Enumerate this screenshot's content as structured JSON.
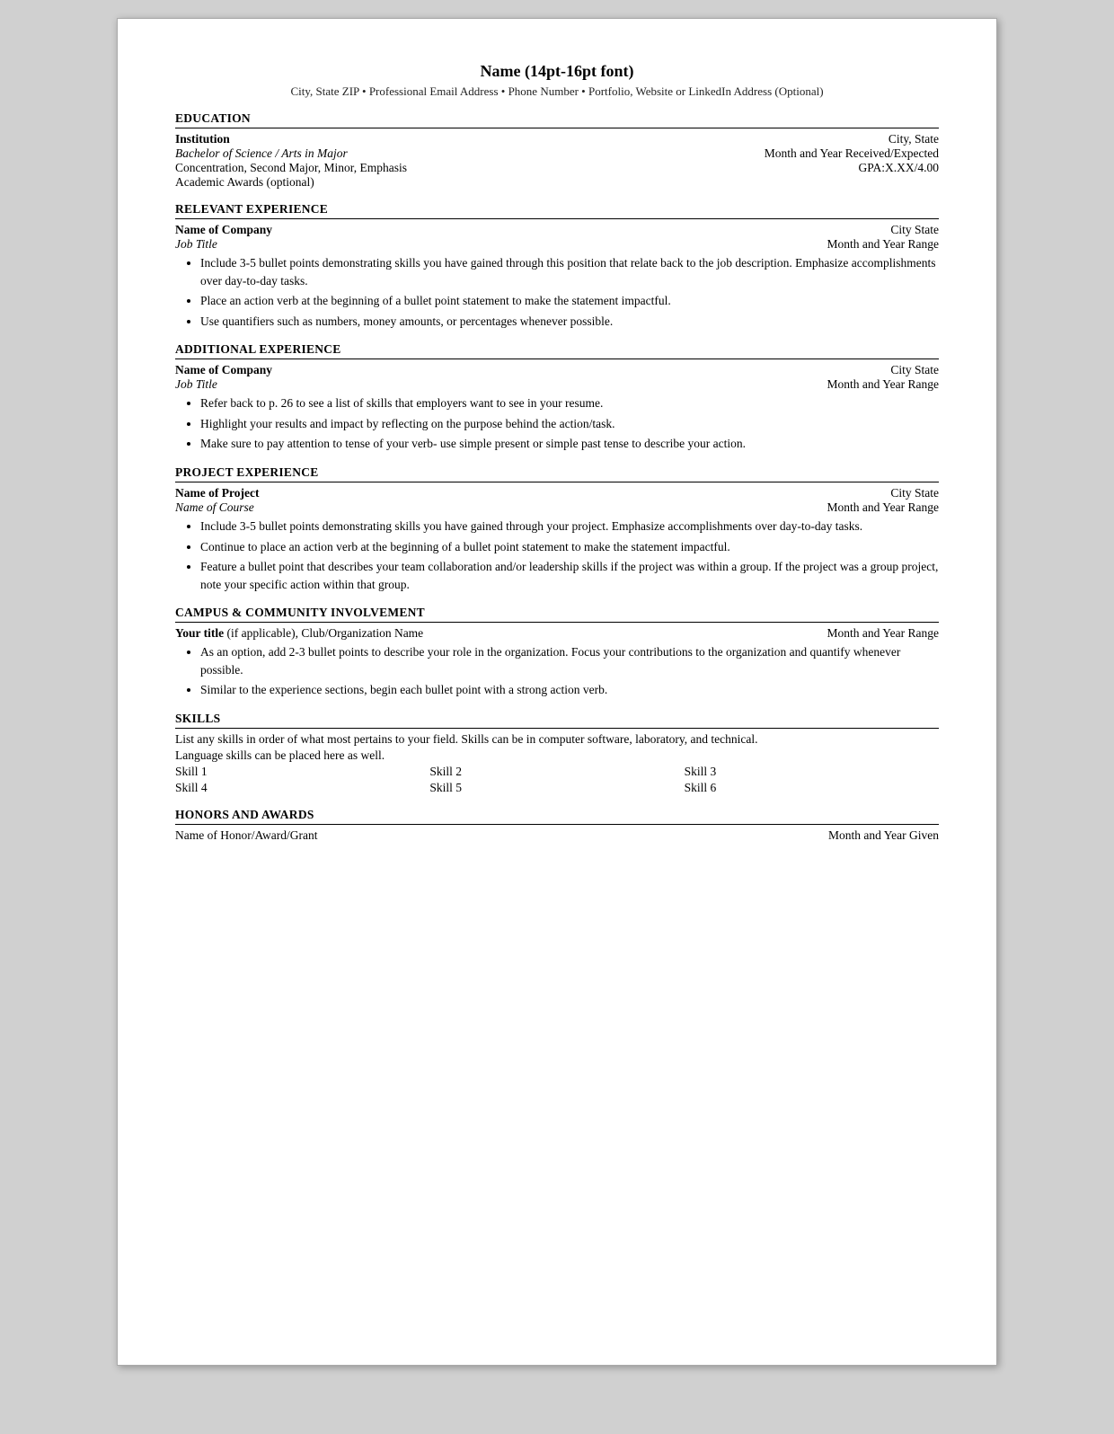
{
  "header": {
    "name": "Name (14pt-16pt font)",
    "contact": "City, State  ZIP • Professional Email Address • Phone Number • Portfolio, Website or LinkedIn Address (Optional)"
  },
  "sections": {
    "education": {
      "title": "EDUCATION",
      "institution": "Institution",
      "city_state": "City, State",
      "degree": "Bachelor of Science / Arts in Major",
      "date": "Month and Year Received/Expected",
      "concentration": "Concentration, Second Major, Minor, Emphasis",
      "gpa": "GPA:X.XX/4.00",
      "awards": "Academic Awards (optional)"
    },
    "relevant_experience": {
      "title": "RELEVANT EXPERIENCE",
      "company": "Name of Company",
      "city_state": "City State",
      "job_title": "Job Title",
      "date_range": "Month and Year Range",
      "bullets": [
        "Include 3-5 bullet points demonstrating skills you have gained through this position that relate back to the job description. Emphasize accomplishments over day-to-day tasks.",
        "Place an action verb at the beginning of a bullet point statement to make the statement impactful.",
        "Use quantifiers such as numbers, money amounts, or percentages whenever possible."
      ]
    },
    "additional_experience": {
      "title": "ADDITIONAL EXPERIENCE",
      "company": "Name of Company",
      "city_state": "City State",
      "job_title": "Job Title",
      "date_range": "Month and Year Range",
      "bullets": [
        "Refer back to p. 26 to see a list of skills that employers want to see in your resume.",
        "Highlight your results and impact by reflecting on the purpose behind the action/task.",
        "Make sure to pay attention to tense of your verb- use simple present or simple past tense to describe your action."
      ]
    },
    "project_experience": {
      "title": "PROJECT EXPERIENCE",
      "project_name": "Name of Project",
      "city_state": "City State",
      "course_name": "Name of Course",
      "date_range": "Month and Year Range",
      "bullets": [
        "Include 3-5 bullet points demonstrating skills you have gained through your project. Emphasize accomplishments over day-to-day tasks.",
        "Continue to place an action verb at the beginning of a bullet point statement to make the statement impactful.",
        "Feature a bullet point that describes your team collaboration and/or leadership skills if the project was within a group. If the project was a group project, note your specific action within that group."
      ]
    },
    "campus_involvement": {
      "title": "CAMPUS & COMMUNITY INVOLVEMENT",
      "title_bold": "Your title",
      "title_rest": " (if applicable), Club/Organization Name",
      "date_range": "Month and Year Range",
      "bullets": [
        "As an option, add 2-3 bullet points to describe your role in the organization. Focus your contributions to the organization and quantify whenever possible.",
        "Similar to the experience sections, begin each bullet point with a strong action verb."
      ]
    },
    "skills": {
      "title": "SKILLS",
      "description1": "List any skills in order of what most pertains to your field.  Skills can be in computer software, laboratory, and technical.",
      "description2": "Language skills can be placed here as well.",
      "grid": [
        [
          "Skill 1",
          "Skill 2",
          "Skill 3"
        ],
        [
          "Skill 4",
          "Skill 5",
          "Skill 6"
        ]
      ]
    },
    "honors": {
      "title": "HONORS AND AWARDS",
      "award_name": "Name of Honor/Award/Grant",
      "date": "Month and Year Given"
    }
  }
}
